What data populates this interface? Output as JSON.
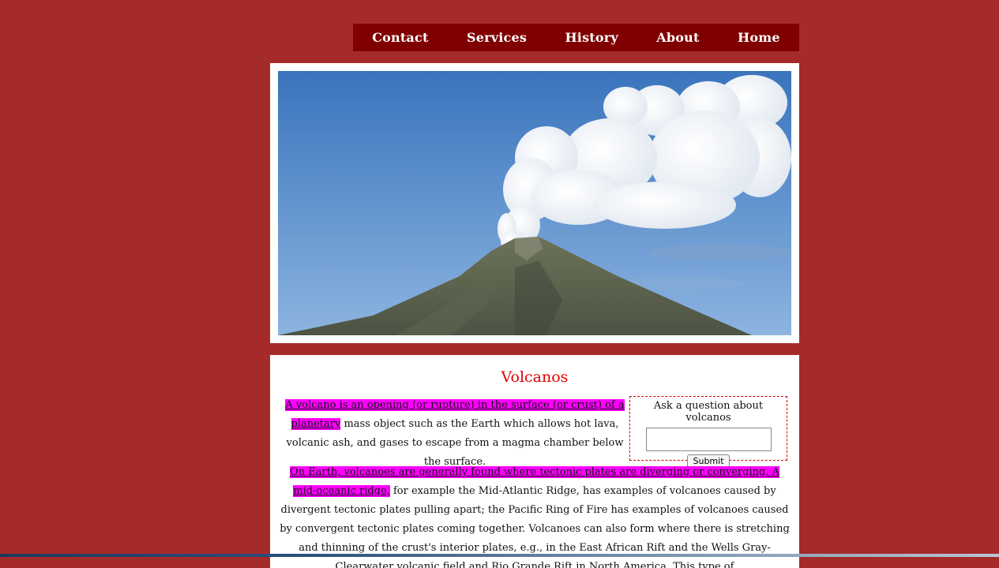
{
  "nav": {
    "items": [
      {
        "label": "Contact"
      },
      {
        "label": "Services"
      },
      {
        "label": "History"
      },
      {
        "label": "About"
      },
      {
        "label": "Home"
      }
    ]
  },
  "hero": {
    "icon": "volcano-photo"
  },
  "article": {
    "title": "Volcanos",
    "intro_highlight": "A volcano is an opening (or rupture) in the surface (or crust) of a planetary",
    "intro_rest": " mass object such as the Earth which allows hot lava, volcanic ash, and gases to escape from a magma chamber below the surface.",
    "body_highlight": "On Earth, volcanoes are generally found where tectonic plates are diverging or converging. A mid-oceanic ridge,",
    "body_rest": " for example the Mid-Atlantic Ridge, has examples of volcanoes caused by divergent tectonic plates pulling apart; the Pacific Ring of Fire has examples of volcanoes caused by convergent tectonic plates coming together. Volcanoes can also form where there is stretching and thinning of the crust's interior plates, e.g., in the East African Rift and the Wells Gray-Clearwater volcanic field and Rio Grande Rift in North America. This type of"
  },
  "ask": {
    "label": "Ask a question about volcanos",
    "input_value": "",
    "submit_label": "Submit"
  },
  "colors": {
    "page_bg": "#a52a2a",
    "nav_bg": "#800000",
    "title": "#e00000",
    "highlight": "#ff00ff"
  }
}
